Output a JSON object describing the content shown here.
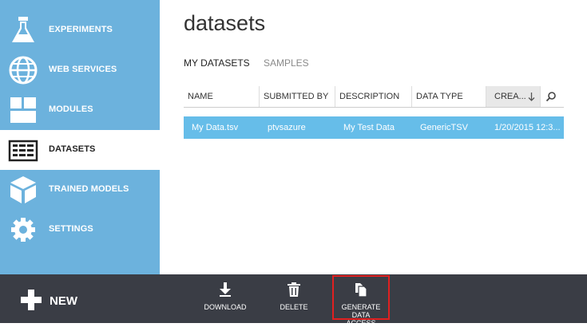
{
  "sidebar": {
    "items": [
      {
        "label": "EXPERIMENTS",
        "icon": "flask-icon"
      },
      {
        "label": "WEB SERVICES",
        "icon": "globe-icon"
      },
      {
        "label": "MODULES",
        "icon": "modules-icon"
      },
      {
        "label": "DATASETS",
        "icon": "datasets-icon",
        "active": true
      },
      {
        "label": "TRAINED MODELS",
        "icon": "cube-icon"
      },
      {
        "label": "SETTINGS",
        "icon": "gear-icon"
      }
    ]
  },
  "main": {
    "title": "datasets",
    "tabs": [
      {
        "label": "MY DATASETS",
        "active": true
      },
      {
        "label": "SAMPLES",
        "active": false
      }
    ],
    "columns": [
      "NAME",
      "SUBMITTED BY",
      "DESCRIPTION",
      "DATA TYPE",
      "CREA..."
    ],
    "sorted_column": "CREA...",
    "sort_direction_icon": "arrow-down-icon",
    "rows": [
      {
        "name": "My Data.tsv",
        "submitted_by": "ptvsazure",
        "description": "My Test Data",
        "data_type": "GenericTSV",
        "created": "1/20/2015 12:3..."
      }
    ]
  },
  "commandbar": {
    "new_label": "NEW",
    "actions": [
      {
        "label": "DOWNLOAD",
        "icon": "download-icon"
      },
      {
        "label": "DELETE",
        "icon": "trash-icon"
      },
      {
        "label": "GENERATE DATA ACCESS CODE...",
        "label_line1": "GENERATE DATA",
        "label_line2": "ACCESS CODE...",
        "icon": "copy-icon",
        "highlighted": true
      }
    ]
  },
  "colors": {
    "sidebar_bg": "#6cb2dd",
    "selected_row": "#66bde9",
    "commandbar_bg": "#3a3d45",
    "highlight_border": "#e02020"
  }
}
